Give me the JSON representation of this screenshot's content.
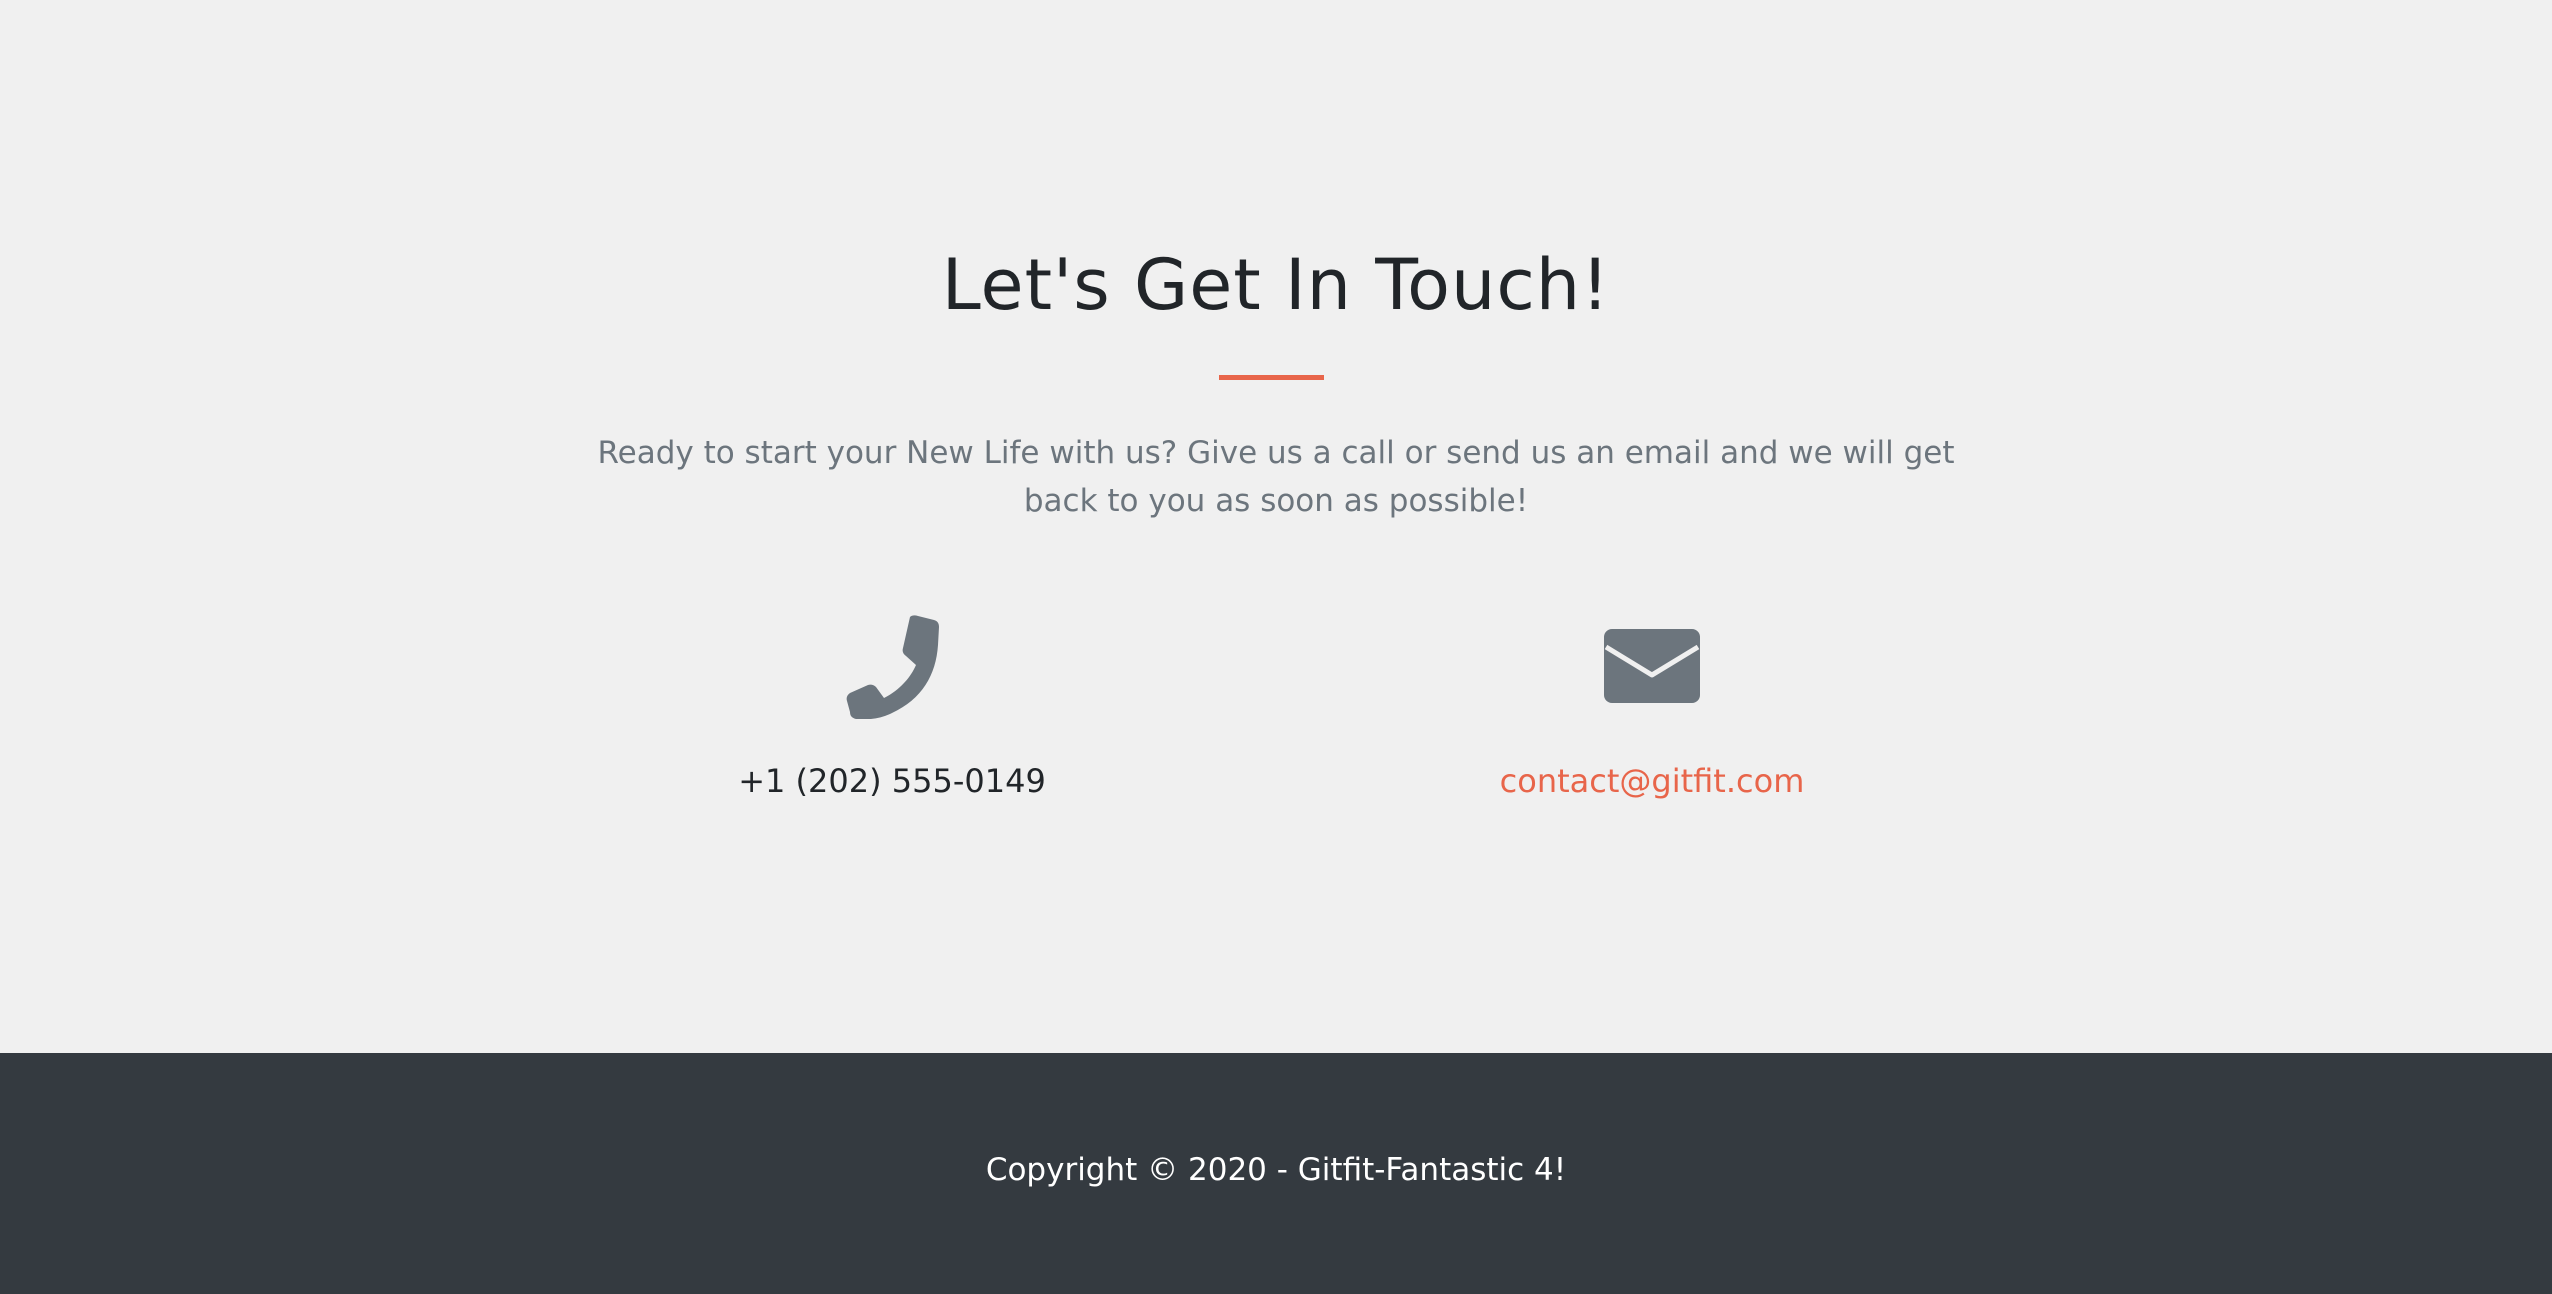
{
  "contact": {
    "title": "Let's Get In Touch!",
    "lead": "Ready to start your New Life with us? Give us a call or send us an email and we will get back to you as soon as possible!",
    "phone": {
      "icon": "phone-icon",
      "number": "+1 (202) 555-0149"
    },
    "email": {
      "icon": "envelope-icon",
      "address": "contact@gitfit.com"
    }
  },
  "footer": {
    "copyright": "Copyright © 2020 - Gitfit-Fantastic 4!"
  },
  "colors": {
    "accent": "#e8654a",
    "icon": "#6c757d",
    "background": "#f0f0f0",
    "footer_bg": "#343a40",
    "heading": "#212529"
  }
}
